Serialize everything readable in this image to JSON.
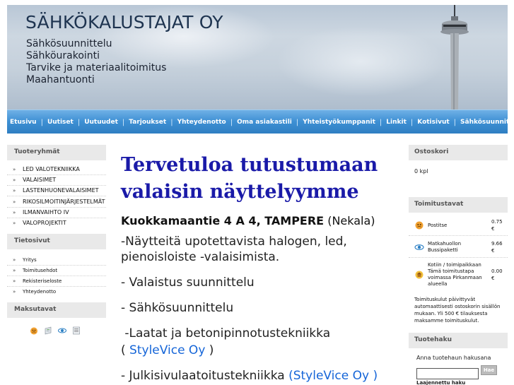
{
  "header": {
    "title": "SÄHKÖKALUSTAJAT OY",
    "taglines": [
      "Sähkösuunnittelu",
      "Sähköurakointi",
      "Tarvike ja materiaalitoimitus",
      "Maahantuonti"
    ]
  },
  "nav": {
    "items": [
      "Etusivu",
      "Uutiset",
      "Uutuudet",
      "Tarjoukset",
      "Yhteydenotto",
      "Oma asiakastili",
      "Yhteistyökumppanit",
      "Linkit",
      "Kotisivut",
      "Sähkösuunnittelu"
    ]
  },
  "left": {
    "groups_title": "Tuoteryhmät",
    "groups": [
      "LED VALOTEKNIIKKA",
      "VALAISIMET",
      "LASTENHUONEVALAISIMET",
      "RIKOSILMOITINJÄRJESTELMÄT",
      "ILMANVAIHTO IV",
      "VALOPROJEKTIT"
    ],
    "info_title": "Tietosivut",
    "info": [
      "Yritys",
      "Toimitusehdot",
      "Rekisteriseloste",
      "Yhteydenotto"
    ],
    "payment_title": "Maksutavat",
    "payment_icons": [
      "cash-on-delivery-icon",
      "invoice-icon",
      "bus-parcel-icon",
      "bank-transfer-icon"
    ]
  },
  "main": {
    "heading": "Tervetuloa tutustumaan valaisin näyttelyymme",
    "address_bold": "Kuokkamaantie 4 A 4, TAMPERE",
    "address_rest": " (Nekala)",
    "line1": "-Näytteitä upotettavista halogen, led, pienoisloiste -valaisimista.",
    "line2": "- Valaistus suunnittelu",
    "line3": "- Sähkösuunnittelu",
    "line4": " -Laatat ja betonipinnotustekniikka",
    "line5_pre": "( ",
    "line5_link": "StyleVice Oy",
    "line5_post": " )",
    "line6_pre": "- Julkisivulaatoitustekniikka ",
    "line6_link": "(StyleVice Oy )"
  },
  "right": {
    "cart_title": "Ostoskori",
    "cart_value": "0 kpl",
    "shipping_title": "Toimitustavat",
    "shipping": [
      {
        "name": "Postitse",
        "price": "0.75 €"
      },
      {
        "name": "Matkahuollon Bussipaketti",
        "price": "9.66 €"
      },
      {
        "name": "Kotiin / toimipaikkaan Tämä toimitustapa voimassa Pirkanmaan alueella",
        "price": "0.00 €"
      }
    ],
    "shipping_note": "Toimituskulut päivittyvät automaattisesti ostoskorin sisällön mukaan. Yli 500 € tilauksesta maksamme toimituskulut.",
    "search_title": "Tuotehaku",
    "search_prompt": "Anna tuotehaun hakusana",
    "search_button": "Hae",
    "advanced_search": "Laajennettu haku"
  }
}
